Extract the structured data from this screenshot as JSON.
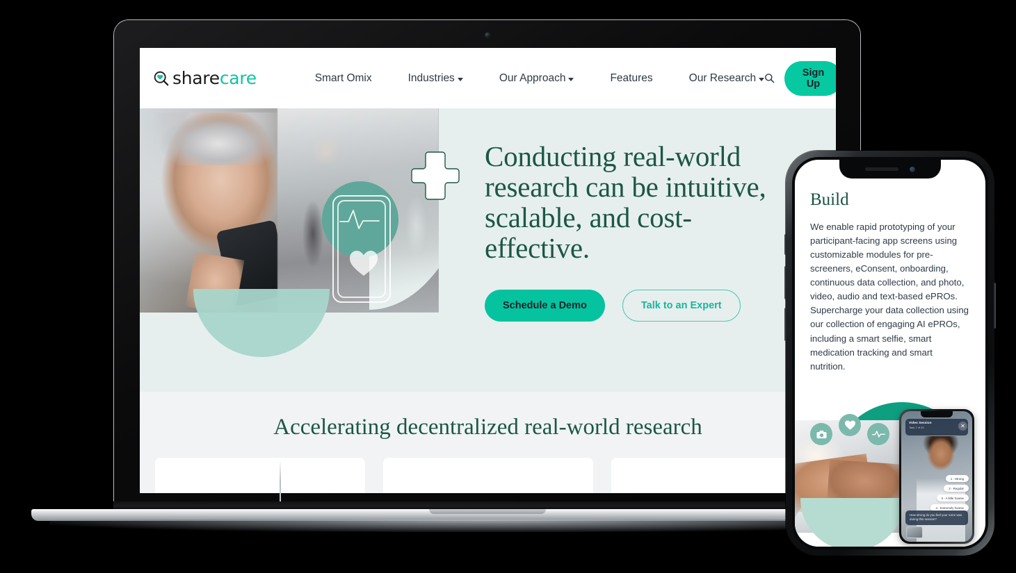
{
  "brand": {
    "logo_text_dark": "share",
    "logo_text_teal": "care",
    "logo_icon": "magnifier-heart-icon",
    "accent_teal": "#06c9a1",
    "dark_green": "#1b5744",
    "hero_bg": "#e7efee",
    "lower_bg": "#f1f3f4"
  },
  "nav": {
    "items": [
      {
        "label": "Smart Omix",
        "has_caret": false
      },
      {
        "label": "Industries",
        "has_caret": true
      },
      {
        "label": "Our Approach",
        "has_caret": true
      },
      {
        "label": "Features",
        "has_caret": false
      },
      {
        "label": "Our Research",
        "has_caret": true
      }
    ],
    "search_icon": "search-icon",
    "signup_label": "Sign Up"
  },
  "hero": {
    "headline_line1": "Conducting real-world",
    "headline_line2": "research can be intuitive,",
    "headline_line3": "scalable, and cost-effective.",
    "primary_cta": "Schedule a Demo",
    "secondary_cta": "Talk to an Expert",
    "pulse_icon": "heartbeat-pulse-icon",
    "heart_icon": "heart-icon",
    "plus_icon": "medical-plus-icon",
    "photo_alt": "senior-woman-using-smartphone"
  },
  "lower": {
    "heading": "Accelerating decentralized real-world research",
    "cards": [
      {
        "id": "card-1"
      },
      {
        "id": "card-2"
      },
      {
        "id": "card-3"
      }
    ]
  },
  "phone": {
    "title": "Build",
    "body": "We enable rapid prototyping of your participant-facing app screens using customizable modules for pre-screeners, eConsent, onboarding, continuous data collection, and photo, video, audio and text-based ePROs. Supercharge your data collection using our collection of engaging AI ePROs, including a smart selfie, smart medication tracking and smart nutrition.",
    "figure": {
      "icons": [
        "camera-icon",
        "heart-icon",
        "pulse-icon"
      ],
      "photo_alt": "hands-typing-on-laptop"
    },
    "mini_app": {
      "header_title": "Video Session",
      "header_sub": "Task 7 of 20",
      "close_icon": "close-icon",
      "options": [
        "1 - Strong",
        "2 - Regular",
        "3 - A little hoarse",
        "4 - Extremely hoarse"
      ],
      "question": "How strong do you feel your voice was during this session?",
      "self_view": "self-view-thumbnail"
    }
  },
  "devices": {
    "laptop_label": "laptop-device-mockup",
    "phone_label": "phone-device-mockup"
  }
}
